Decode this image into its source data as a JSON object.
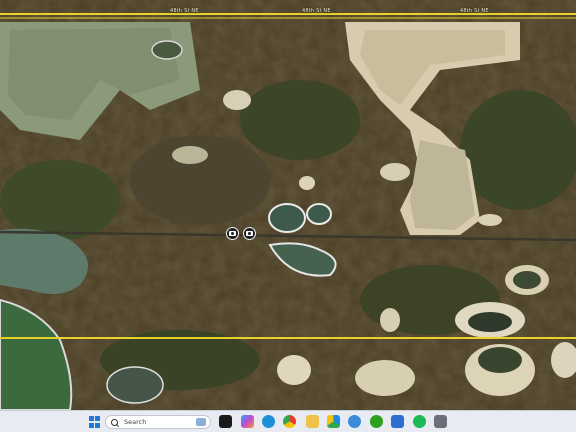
{
  "map": {
    "road_labels": [
      "48th St NE",
      "48th St NE",
      "48th St NE"
    ],
    "markers": [
      {
        "name": "camera-marker-1",
        "icon": "camera-icon"
      },
      {
        "name": "camera-marker-2",
        "icon": "camera-icon"
      }
    ],
    "colors": {
      "road": "#e6d22a",
      "water": "#4e6f5c",
      "sand": "#d9cfb5",
      "marsh": "#4a3e24"
    }
  },
  "taskbar": {
    "search_placeholder": "Search",
    "icons": [
      "copilot-icon",
      "task-view-icon",
      "colored-app-icon",
      "edge-icon",
      "chrome-icon",
      "file-explorer-icon",
      "google-drive-icon",
      "photos-icon",
      "chrome-2-icon",
      "quickbooks-icon",
      "snipping-tool-icon",
      "spotify-icon",
      "pin-app-icon"
    ]
  }
}
